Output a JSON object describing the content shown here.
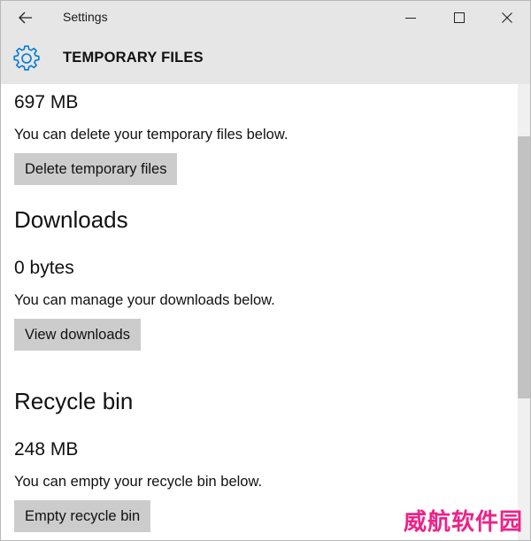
{
  "titlebar": {
    "app_title": "Settings",
    "back_icon": "arrow-left-icon",
    "minimize_icon": "minimize-icon",
    "maximize_icon": "maximize-icon",
    "close_icon": "close-icon"
  },
  "header": {
    "icon": "gear-icon",
    "title": "TEMPORARY FILES"
  },
  "sections": {
    "temp": {
      "size": "697 MB",
      "description": "You can delete your temporary files below.",
      "button_label": "Delete temporary files"
    },
    "downloads": {
      "heading": "Downloads",
      "size": "0 bytes",
      "description": "You can manage your downloads below.",
      "button_label": "View downloads"
    },
    "recycle": {
      "heading": "Recycle bin",
      "size": "248 MB",
      "description": "You can empty your recycle bin below.",
      "button_label": "Empty recycle bin"
    }
  },
  "watermark": "威航软件园",
  "colors": {
    "titlebar_bg": "#e6e6e6",
    "button_bg": "#cccccc",
    "accent": "#0078d7",
    "watermark": "#ee2288"
  }
}
